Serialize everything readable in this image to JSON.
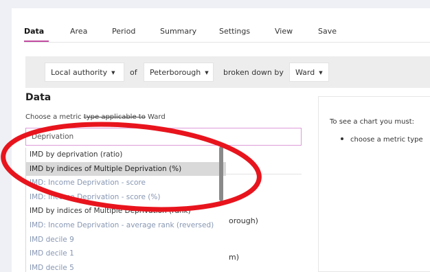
{
  "tabs": [
    {
      "label": "Data",
      "active": true
    },
    {
      "label": "Area"
    },
    {
      "label": "Period"
    },
    {
      "label": "Summary"
    },
    {
      "label": "Settings"
    },
    {
      "label": "View"
    },
    {
      "label": "Save"
    }
  ],
  "filter_bar": {
    "area_type": "Local authority",
    "of_text": "of",
    "area": "Peterborough",
    "broken_down_text": "broken down by",
    "breakdown": "Ward"
  },
  "data_section": {
    "title": "Data",
    "helper_prefix": "Choose a metric ",
    "helper_strike": "type applicable to",
    "helper_suffix": " Ward",
    "search_value": "Deprivation"
  },
  "dropdown_items": [
    {
      "label": "IMD by deprivation (ratio)",
      "dim": false,
      "selected": false
    },
    {
      "label": "IMD by indices of Multiple Deprivation (%)",
      "dim": false,
      "selected": true
    },
    {
      "label": "IMD: Income Deprivation - score",
      "dim": true,
      "selected": false
    },
    {
      "label": "IMD: Income Deprivation - score (%)",
      "dim": true,
      "selected": false
    },
    {
      "label": "IMD by indices of Multiple Deprivation (rank)",
      "dim": false,
      "selected": false
    },
    {
      "label": "IMD: Income Deprivation - average rank (reversed)",
      "dim": true,
      "selected": false
    },
    {
      "label": "IMD decile 9",
      "dim": true,
      "selected": false
    },
    {
      "label": "IMD decile 1",
      "dim": true,
      "selected": false
    },
    {
      "label": "IMD decile 5",
      "dim": true,
      "selected": false
    }
  ],
  "behind_text": {
    "line1": "orough)",
    "line2": "m)"
  },
  "chart_panel": {
    "hint": "To see a chart you must:",
    "bullet": "choose a metric type"
  },
  "colors": {
    "accent": "#c14aa0",
    "input_border": "#dc9ad8",
    "annotation_red": "#e8141d"
  }
}
